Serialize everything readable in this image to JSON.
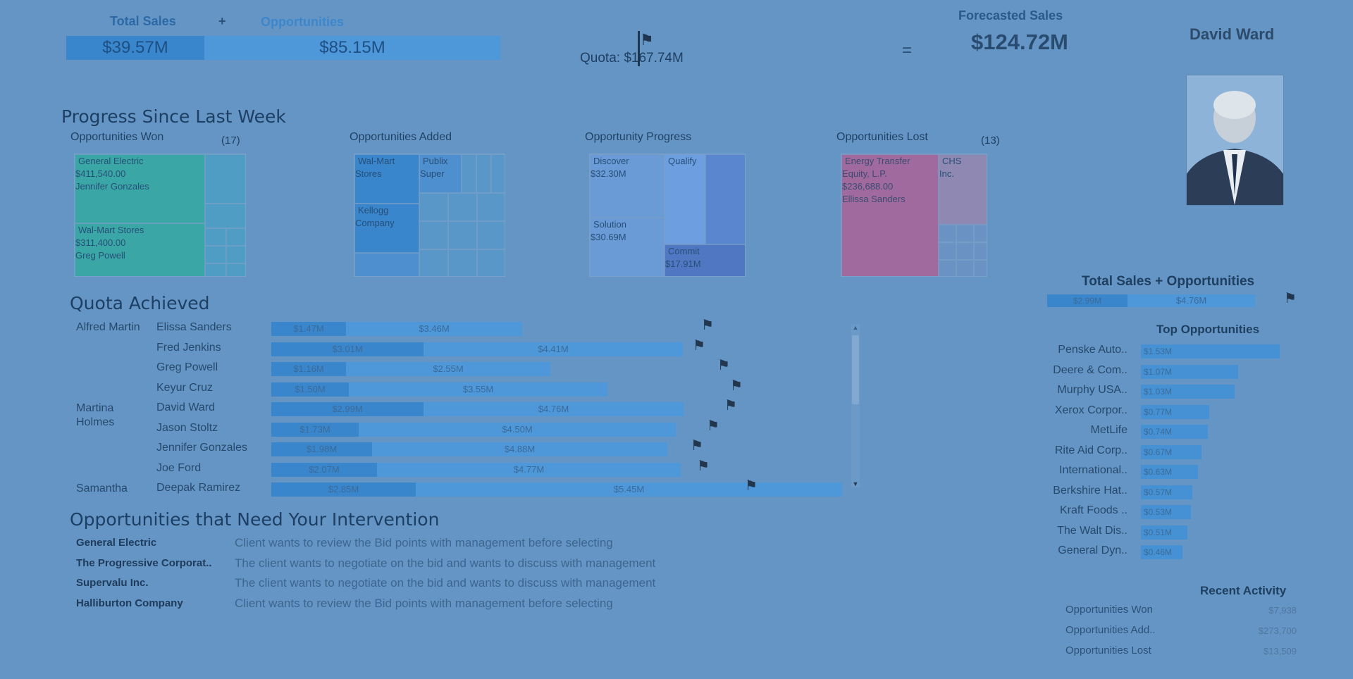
{
  "header": {
    "total_sales_label": "Total Sales",
    "plus": "+",
    "opportunities_label": "Opportunities",
    "total_sales_value": "$39.57M",
    "opportunities_value": "$85.15M",
    "quota_text": "Quota: $167.74M",
    "equals": "=",
    "forecast_label": "Forecasted Sales",
    "forecast_value": "$124.72M",
    "person_name": "David Ward"
  },
  "progress": {
    "title": "Progress Since Last Week",
    "won": {
      "title": "Opportunities Won",
      "count": "(17)",
      "item1": "General Electric\n$411,540.00\nJennifer Gonzales",
      "item2": "Wal-Mart Stores\n$311,400.00\nGreg Powell"
    },
    "added": {
      "title": "Opportunities Added",
      "item1": "Wal-Mart\nStores",
      "item2": "Publix\nSuper",
      "item3": "Kellogg\nCompany"
    },
    "progress": {
      "title": "Opportunity Progress",
      "item1": "Discover\n$32.30M",
      "item2": "Qualify",
      "item3": "Solution\n$30.69M",
      "item4": "Commit\n$17.91M"
    },
    "lost": {
      "title": "Opportunities Lost",
      "count": "(13)",
      "item1": "Energy Transfer\nEquity, L.P.\n$236,688.00\nEllissa Sanders",
      "item2": "CHS\nInc."
    }
  },
  "quota": {
    "title": "Quota Achieved",
    "managers": [
      "Alfred Martin",
      "Martina\nHolmes",
      "Samantha"
    ],
    "rows": [
      {
        "name": "Elissa Sanders",
        "won": "$1.47M",
        "opp": "$3.46M"
      },
      {
        "name": "Fred Jenkins",
        "won": "$3.01M",
        "opp": "$4.41M"
      },
      {
        "name": "Greg Powell",
        "won": "$1.16M",
        "opp": "$2.55M"
      },
      {
        "name": "Keyur Cruz",
        "won": "$1.50M",
        "opp": "$3.55M"
      },
      {
        "name": "David Ward",
        "won": "$2.99M",
        "opp": "$4.76M"
      },
      {
        "name": "Jason Stoltz",
        "won": "$1.73M",
        "opp": "$4.50M"
      },
      {
        "name": "Jennifer Gonzales",
        "won": "$1.98M",
        "opp": "$4.88M"
      },
      {
        "name": "Joe Ford",
        "won": "$2.07M",
        "opp": "$4.77M"
      },
      {
        "name": "Deepak Ramirez",
        "won": "$2.85M",
        "opp": "$5.45M"
      }
    ]
  },
  "intervention": {
    "title": "Opportunities that Need Your Intervention",
    "rows": [
      {
        "company": "General Electric",
        "note": "Client wants to review the Bid points with management before selecting"
      },
      {
        "company": "The Progressive Corporat..",
        "note": "The client wants to negotiate on the bid and wants to discuss with management"
      },
      {
        "company": "Supervalu Inc.",
        "note": "The client wants to negotiate on the bid and wants to discuss with management"
      },
      {
        "company": "Halliburton Company",
        "note": "Client wants to review the Bid points with management before selecting"
      }
    ]
  },
  "right_panel": {
    "tso_title": "Total Sales + Opportunities",
    "tso_won": "$2.99M",
    "tso_opp": "$4.76M",
    "top_title": "Top Opportunities",
    "top": [
      {
        "name": "Penske Auto..",
        "value": "$1.53M"
      },
      {
        "name": "Deere & Com..",
        "value": "$1.07M"
      },
      {
        "name": "Murphy USA..",
        "value": "$1.03M"
      },
      {
        "name": "Xerox Corpor..",
        "value": "$0.77M"
      },
      {
        "name": "MetLife",
        "value": "$0.74M"
      },
      {
        "name": "Rite Aid Corp..",
        "value": "$0.67M"
      },
      {
        "name": "International..",
        "value": "$0.63M"
      },
      {
        "name": "Berkshire Hat..",
        "value": "$0.57M"
      },
      {
        "name": "Kraft Foods ..",
        "value": "$0.53M"
      },
      {
        "name": "The Walt Dis..",
        "value": "$0.51M"
      },
      {
        "name": "General Dyn..",
        "value": "$0.46M"
      }
    ],
    "recent_title": "Recent Activity",
    "recent": [
      {
        "name": "Opportunities Won",
        "value": "$7,938"
      },
      {
        "name": "Opportunities Add..",
        "value": "$273,700"
      },
      {
        "name": "Opportunities Lost",
        "value": "$13,509"
      }
    ]
  },
  "colors": {
    "background": "#6595c4",
    "won_bar": "#3a86cc",
    "opp_bar": "#4e97d9",
    "teal": "#3aa6a5",
    "lost": "#a06a9e"
  },
  "icons": [
    "flag-icon",
    "photo-person-icon",
    "scroll-up-icon",
    "scroll-down-icon"
  ]
}
